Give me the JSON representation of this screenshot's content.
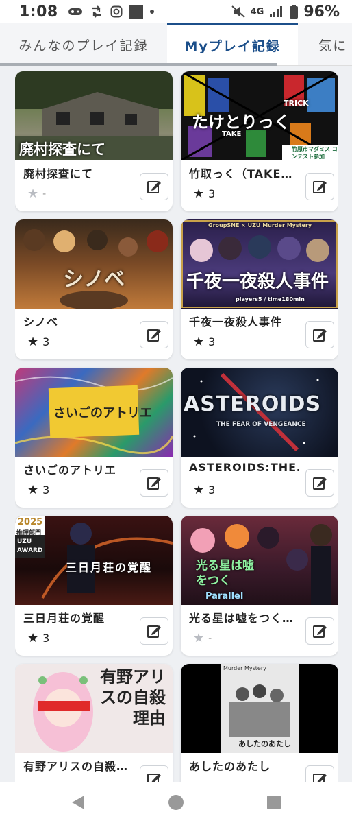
{
  "status_bar": {
    "time": "1:08",
    "network": "4G",
    "battery": "96%"
  },
  "tabs": [
    {
      "label": "みんなのプレイ記録",
      "active": false
    },
    {
      "label": "Myプレイ記録",
      "active": true
    },
    {
      "label": "気に",
      "active": false
    }
  ],
  "cards": [
    {
      "title": "廃村探査にて",
      "rating": "-",
      "rated": false,
      "thumb_text": "廃村探査にて"
    },
    {
      "title": "竹取っく（TAKE…",
      "rating": "3",
      "rated": true,
      "thumb_text": "たけとりっく",
      "thumb_sub": "TRICK",
      "thumb_sub2": "TAKE",
      "badge": "竹原市マダミス コンテスト参加"
    },
    {
      "title": "シノベ",
      "rating": "3",
      "rated": true,
      "thumb_text": "シノベ"
    },
    {
      "title": "千夜一夜殺人事件",
      "rating": "3",
      "rated": true,
      "thumb_text": "千夜一夜殺人事件",
      "thumb_sub": "GroupSNE × UZU Murder Mystery",
      "thumb_sub2": "players5 / time180min"
    },
    {
      "title": "さいごのアトリエ",
      "rating": "3",
      "rated": true,
      "thumb_text": "さいごのアトリエ"
    },
    {
      "title": "ASTEROIDS:THE…",
      "rating": "3",
      "rated": true,
      "thumb_text": "ASTEROIDS",
      "thumb_sub": "THE FEAR OF VENGEANCE"
    },
    {
      "title": "三日月荘の覚醒",
      "rating": "3",
      "rated": true,
      "thumb_text": "三日月荘の覚醒",
      "thumb_sub": "2025",
      "thumb_sub2": "推理部門",
      "badge": "UZU AWARD"
    },
    {
      "title": "光る星は嘘をつく…",
      "rating": "-",
      "rated": false,
      "thumb_text": "光る星は嘘をつく",
      "thumb_sub": "Parallel"
    },
    {
      "title": "有野アリスの自殺…",
      "rating": "",
      "rated": false,
      "thumb_text": "有野アリスの自殺理由"
    },
    {
      "title": "あしたのあたし",
      "rating": "",
      "rated": false,
      "thumb_text": "あしたのあたし",
      "thumb_sub": "Murder Mystery"
    }
  ],
  "colors": {
    "accent": "#1c4f8a",
    "background": "#eef0f3",
    "star_filled": "#222222",
    "star_empty": "#b9bcc2"
  },
  "icons": {
    "edit": "edit-pencil-icon",
    "star": "star-icon",
    "nav_back": "back-triangle-icon",
    "nav_home": "home-circle-icon",
    "nav_recents": "recents-square-icon"
  }
}
